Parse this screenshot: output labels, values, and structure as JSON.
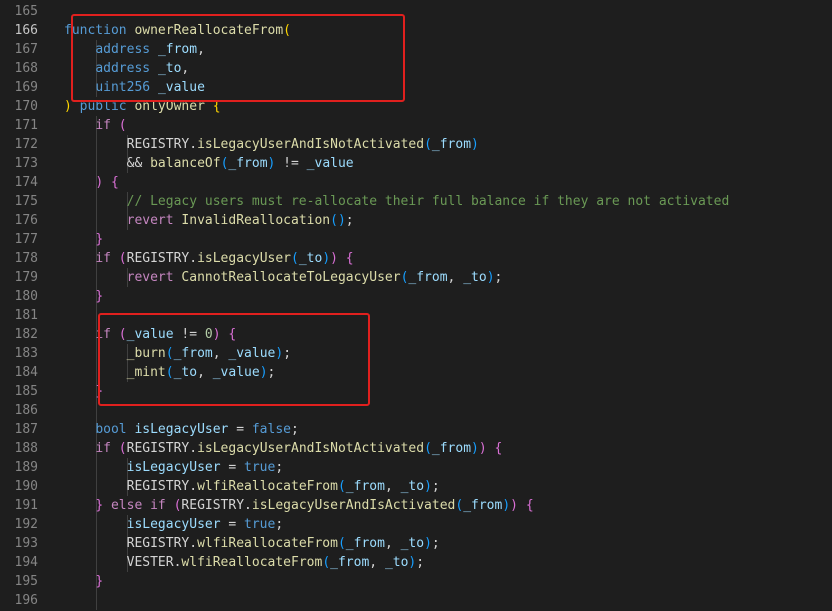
{
  "editor": {
    "language": "solidity",
    "theme": "dark",
    "colors": {
      "background": "#1e1e1e",
      "line_number": "#858585",
      "active_line_number": "#c6c6c6",
      "highlight_box": "#e0201e",
      "keyword": "#569cd6",
      "control": "#c586c0",
      "function": "#dcdcaa",
      "variable": "#9cdcfe",
      "type": "#4ec9b0",
      "number": "#b5cea8",
      "comment": "#6a9955",
      "bracket_1": "#ffd700",
      "bracket_2": "#da70d6",
      "bracket_3": "#179fff"
    },
    "lines": [
      {
        "number": "165",
        "tokens": []
      },
      {
        "number": "166",
        "tokens": [
          {
            "t": "function ",
            "c": "kw-blue"
          },
          {
            "t": "ownerReallocateFrom",
            "c": "fn"
          },
          {
            "t": "(",
            "c": "p1"
          }
        ]
      },
      {
        "number": "167",
        "tokens": [
          {
            "t": "    ",
            "c": "plain"
          },
          {
            "t": "address",
            "c": "kw-blue"
          },
          {
            "t": " ",
            "c": "plain"
          },
          {
            "t": "_from",
            "c": "var"
          },
          {
            "t": ",",
            "c": "plain"
          }
        ]
      },
      {
        "number": "168",
        "tokens": [
          {
            "t": "    ",
            "c": "plain"
          },
          {
            "t": "address",
            "c": "kw-blue"
          },
          {
            "t": " ",
            "c": "plain"
          },
          {
            "t": "_to",
            "c": "var"
          },
          {
            "t": ",",
            "c": "plain"
          }
        ]
      },
      {
        "number": "169",
        "tokens": [
          {
            "t": "    ",
            "c": "plain"
          },
          {
            "t": "uint256",
            "c": "kw-blue"
          },
          {
            "t": " ",
            "c": "plain"
          },
          {
            "t": "_value",
            "c": "var"
          }
        ]
      },
      {
        "number": "170",
        "tokens": [
          {
            "t": ")",
            "c": "p1"
          },
          {
            "t": " ",
            "c": "plain"
          },
          {
            "t": "public",
            "c": "kw-blue"
          },
          {
            "t": " ",
            "c": "plain"
          },
          {
            "t": "onlyOwner",
            "c": "fn"
          },
          {
            "t": " ",
            "c": "plain"
          },
          {
            "t": "{",
            "c": "p1"
          }
        ]
      },
      {
        "number": "171",
        "tokens": [
          {
            "t": "    ",
            "c": "plain"
          },
          {
            "t": "if",
            "c": "kw-ctrl"
          },
          {
            "t": " ",
            "c": "plain"
          },
          {
            "t": "(",
            "c": "p2"
          }
        ]
      },
      {
        "number": "172",
        "tokens": [
          {
            "t": "        ",
            "c": "plain"
          },
          {
            "t": "REGISTRY",
            "c": "plain"
          },
          {
            "t": ".",
            "c": "plain"
          },
          {
            "t": "isLegacyUserAndIsNotActivated",
            "c": "fn"
          },
          {
            "t": "(",
            "c": "p3"
          },
          {
            "t": "_from",
            "c": "var"
          },
          {
            "t": ")",
            "c": "p3"
          }
        ]
      },
      {
        "number": "173",
        "tokens": [
          {
            "t": "        ",
            "c": "plain"
          },
          {
            "t": "&& ",
            "c": "plain"
          },
          {
            "t": "balanceOf",
            "c": "fn"
          },
          {
            "t": "(",
            "c": "p3"
          },
          {
            "t": "_from",
            "c": "var"
          },
          {
            "t": ")",
            "c": "p3"
          },
          {
            "t": " != ",
            "c": "plain"
          },
          {
            "t": "_value",
            "c": "var"
          }
        ]
      },
      {
        "number": "174",
        "tokens": [
          {
            "t": "    ",
            "c": "plain"
          },
          {
            "t": ")",
            "c": "p2"
          },
          {
            "t": " ",
            "c": "plain"
          },
          {
            "t": "{",
            "c": "p2"
          }
        ]
      },
      {
        "number": "175",
        "tokens": [
          {
            "t": "        ",
            "c": "plain"
          },
          {
            "t": "// Legacy users must re-allocate their full balance if they are not activated",
            "c": "cmt"
          }
        ]
      },
      {
        "number": "176",
        "tokens": [
          {
            "t": "        ",
            "c": "plain"
          },
          {
            "t": "revert",
            "c": "kw-ctrl"
          },
          {
            "t": " ",
            "c": "plain"
          },
          {
            "t": "InvalidReallocation",
            "c": "fn"
          },
          {
            "t": "(",
            "c": "p3"
          },
          {
            "t": ")",
            "c": "p3"
          },
          {
            "t": ";",
            "c": "plain"
          }
        ]
      },
      {
        "number": "177",
        "tokens": [
          {
            "t": "    ",
            "c": "plain"
          },
          {
            "t": "}",
            "c": "p2"
          }
        ]
      },
      {
        "number": "178",
        "tokens": [
          {
            "t": "    ",
            "c": "plain"
          },
          {
            "t": "if",
            "c": "kw-ctrl"
          },
          {
            "t": " ",
            "c": "plain"
          },
          {
            "t": "(",
            "c": "p2"
          },
          {
            "t": "REGISTRY",
            "c": "plain"
          },
          {
            "t": ".",
            "c": "plain"
          },
          {
            "t": "isLegacyUser",
            "c": "fn"
          },
          {
            "t": "(",
            "c": "p3"
          },
          {
            "t": "_to",
            "c": "var"
          },
          {
            "t": ")",
            "c": "p3"
          },
          {
            "t": ")",
            "c": "p2"
          },
          {
            "t": " ",
            "c": "plain"
          },
          {
            "t": "{",
            "c": "p2"
          }
        ]
      },
      {
        "number": "179",
        "tokens": [
          {
            "t": "        ",
            "c": "plain"
          },
          {
            "t": "revert",
            "c": "kw-ctrl"
          },
          {
            "t": " ",
            "c": "plain"
          },
          {
            "t": "CannotReallocateToLegacyUser",
            "c": "fn"
          },
          {
            "t": "(",
            "c": "p3"
          },
          {
            "t": "_from",
            "c": "var"
          },
          {
            "t": ", ",
            "c": "plain"
          },
          {
            "t": "_to",
            "c": "var"
          },
          {
            "t": ")",
            "c": "p3"
          },
          {
            "t": ";",
            "c": "plain"
          }
        ]
      },
      {
        "number": "180",
        "tokens": [
          {
            "t": "    ",
            "c": "plain"
          },
          {
            "t": "}",
            "c": "p2"
          }
        ]
      },
      {
        "number": "181",
        "tokens": []
      },
      {
        "number": "182",
        "tokens": [
          {
            "t": "    ",
            "c": "plain"
          },
          {
            "t": "if",
            "c": "kw-ctrl"
          },
          {
            "t": " ",
            "c": "plain"
          },
          {
            "t": "(",
            "c": "p2"
          },
          {
            "t": "_value",
            "c": "var"
          },
          {
            "t": " != ",
            "c": "plain"
          },
          {
            "t": "0",
            "c": "num"
          },
          {
            "t": ")",
            "c": "p2"
          },
          {
            "t": " ",
            "c": "plain"
          },
          {
            "t": "{",
            "c": "p2"
          }
        ]
      },
      {
        "number": "183",
        "tokens": [
          {
            "t": "        ",
            "c": "plain"
          },
          {
            "t": "_burn",
            "c": "fn"
          },
          {
            "t": "(",
            "c": "p3"
          },
          {
            "t": "_from",
            "c": "var"
          },
          {
            "t": ", ",
            "c": "plain"
          },
          {
            "t": "_value",
            "c": "var"
          },
          {
            "t": ")",
            "c": "p3"
          },
          {
            "t": ";",
            "c": "plain"
          }
        ]
      },
      {
        "number": "184",
        "tokens": [
          {
            "t": "        ",
            "c": "plain"
          },
          {
            "t": "_mint",
            "c": "fn"
          },
          {
            "t": "(",
            "c": "p3"
          },
          {
            "t": "_to",
            "c": "var"
          },
          {
            "t": ", ",
            "c": "plain"
          },
          {
            "t": "_value",
            "c": "var"
          },
          {
            "t": ")",
            "c": "p3"
          },
          {
            "t": ";",
            "c": "plain"
          }
        ]
      },
      {
        "number": "185",
        "tokens": [
          {
            "t": "    ",
            "c": "plain"
          },
          {
            "t": "}",
            "c": "p2"
          }
        ]
      },
      {
        "number": "186",
        "tokens": []
      },
      {
        "number": "187",
        "tokens": [
          {
            "t": "    ",
            "c": "plain"
          },
          {
            "t": "bool",
            "c": "kw-blue"
          },
          {
            "t": " ",
            "c": "plain"
          },
          {
            "t": "isLegacyUser",
            "c": "var"
          },
          {
            "t": " = ",
            "c": "plain"
          },
          {
            "t": "false",
            "c": "kw-blue"
          },
          {
            "t": ";",
            "c": "plain"
          }
        ]
      },
      {
        "number": "188",
        "tokens": [
          {
            "t": "    ",
            "c": "plain"
          },
          {
            "t": "if",
            "c": "kw-ctrl"
          },
          {
            "t": " ",
            "c": "plain"
          },
          {
            "t": "(",
            "c": "p2"
          },
          {
            "t": "REGISTRY",
            "c": "plain"
          },
          {
            "t": ".",
            "c": "plain"
          },
          {
            "t": "isLegacyUserAndIsNotActivated",
            "c": "fn"
          },
          {
            "t": "(",
            "c": "p3"
          },
          {
            "t": "_from",
            "c": "var"
          },
          {
            "t": ")",
            "c": "p3"
          },
          {
            "t": ")",
            "c": "p2"
          },
          {
            "t": " ",
            "c": "plain"
          },
          {
            "t": "{",
            "c": "p2"
          }
        ]
      },
      {
        "number": "189",
        "tokens": [
          {
            "t": "        ",
            "c": "plain"
          },
          {
            "t": "isLegacyUser",
            "c": "var"
          },
          {
            "t": " = ",
            "c": "plain"
          },
          {
            "t": "true",
            "c": "kw-blue"
          },
          {
            "t": ";",
            "c": "plain"
          }
        ]
      },
      {
        "number": "190",
        "tokens": [
          {
            "t": "        ",
            "c": "plain"
          },
          {
            "t": "REGISTRY",
            "c": "plain"
          },
          {
            "t": ".",
            "c": "plain"
          },
          {
            "t": "wlfiReallocateFrom",
            "c": "fn"
          },
          {
            "t": "(",
            "c": "p3"
          },
          {
            "t": "_from",
            "c": "var"
          },
          {
            "t": ", ",
            "c": "plain"
          },
          {
            "t": "_to",
            "c": "var"
          },
          {
            "t": ")",
            "c": "p3"
          },
          {
            "t": ";",
            "c": "plain"
          }
        ]
      },
      {
        "number": "191",
        "tokens": [
          {
            "t": "    ",
            "c": "plain"
          },
          {
            "t": "}",
            "c": "p2"
          },
          {
            "t": " ",
            "c": "plain"
          },
          {
            "t": "else",
            "c": "kw-ctrl"
          },
          {
            "t": " ",
            "c": "plain"
          },
          {
            "t": "if",
            "c": "kw-ctrl"
          },
          {
            "t": " ",
            "c": "plain"
          },
          {
            "t": "(",
            "c": "p2"
          },
          {
            "t": "REGISTRY",
            "c": "plain"
          },
          {
            "t": ".",
            "c": "plain"
          },
          {
            "t": "isLegacyUserAndIsActivated",
            "c": "fn"
          },
          {
            "t": "(",
            "c": "p3"
          },
          {
            "t": "_from",
            "c": "var"
          },
          {
            "t": ")",
            "c": "p3"
          },
          {
            "t": ")",
            "c": "p2"
          },
          {
            "t": " ",
            "c": "plain"
          },
          {
            "t": "{",
            "c": "p2"
          }
        ]
      },
      {
        "number": "192",
        "tokens": [
          {
            "t": "        ",
            "c": "plain"
          },
          {
            "t": "isLegacyUser",
            "c": "var"
          },
          {
            "t": " = ",
            "c": "plain"
          },
          {
            "t": "true",
            "c": "kw-blue"
          },
          {
            "t": ";",
            "c": "plain"
          }
        ]
      },
      {
        "number": "193",
        "tokens": [
          {
            "t": "        ",
            "c": "plain"
          },
          {
            "t": "REGISTRY",
            "c": "plain"
          },
          {
            "t": ".",
            "c": "plain"
          },
          {
            "t": "wlfiReallocateFrom",
            "c": "fn"
          },
          {
            "t": "(",
            "c": "p3"
          },
          {
            "t": "_from",
            "c": "var"
          },
          {
            "t": ", ",
            "c": "plain"
          },
          {
            "t": "_to",
            "c": "var"
          },
          {
            "t": ")",
            "c": "p3"
          },
          {
            "t": ";",
            "c": "plain"
          }
        ]
      },
      {
        "number": "194",
        "tokens": [
          {
            "t": "        ",
            "c": "plain"
          },
          {
            "t": "VESTER",
            "c": "plain"
          },
          {
            "t": ".",
            "c": "plain"
          },
          {
            "t": "wlfiReallocateFrom",
            "c": "fn"
          },
          {
            "t": "(",
            "c": "p3"
          },
          {
            "t": "_from",
            "c": "var"
          },
          {
            "t": ", ",
            "c": "plain"
          },
          {
            "t": "_to",
            "c": "var"
          },
          {
            "t": ")",
            "c": "p3"
          },
          {
            "t": ";",
            "c": "plain"
          }
        ]
      },
      {
        "number": "195",
        "tokens": [
          {
            "t": "    ",
            "c": "plain"
          },
          {
            "t": "}",
            "c": "p2"
          }
        ]
      },
      {
        "number": "196",
        "tokens": []
      }
    ],
    "active_line": "166"
  }
}
